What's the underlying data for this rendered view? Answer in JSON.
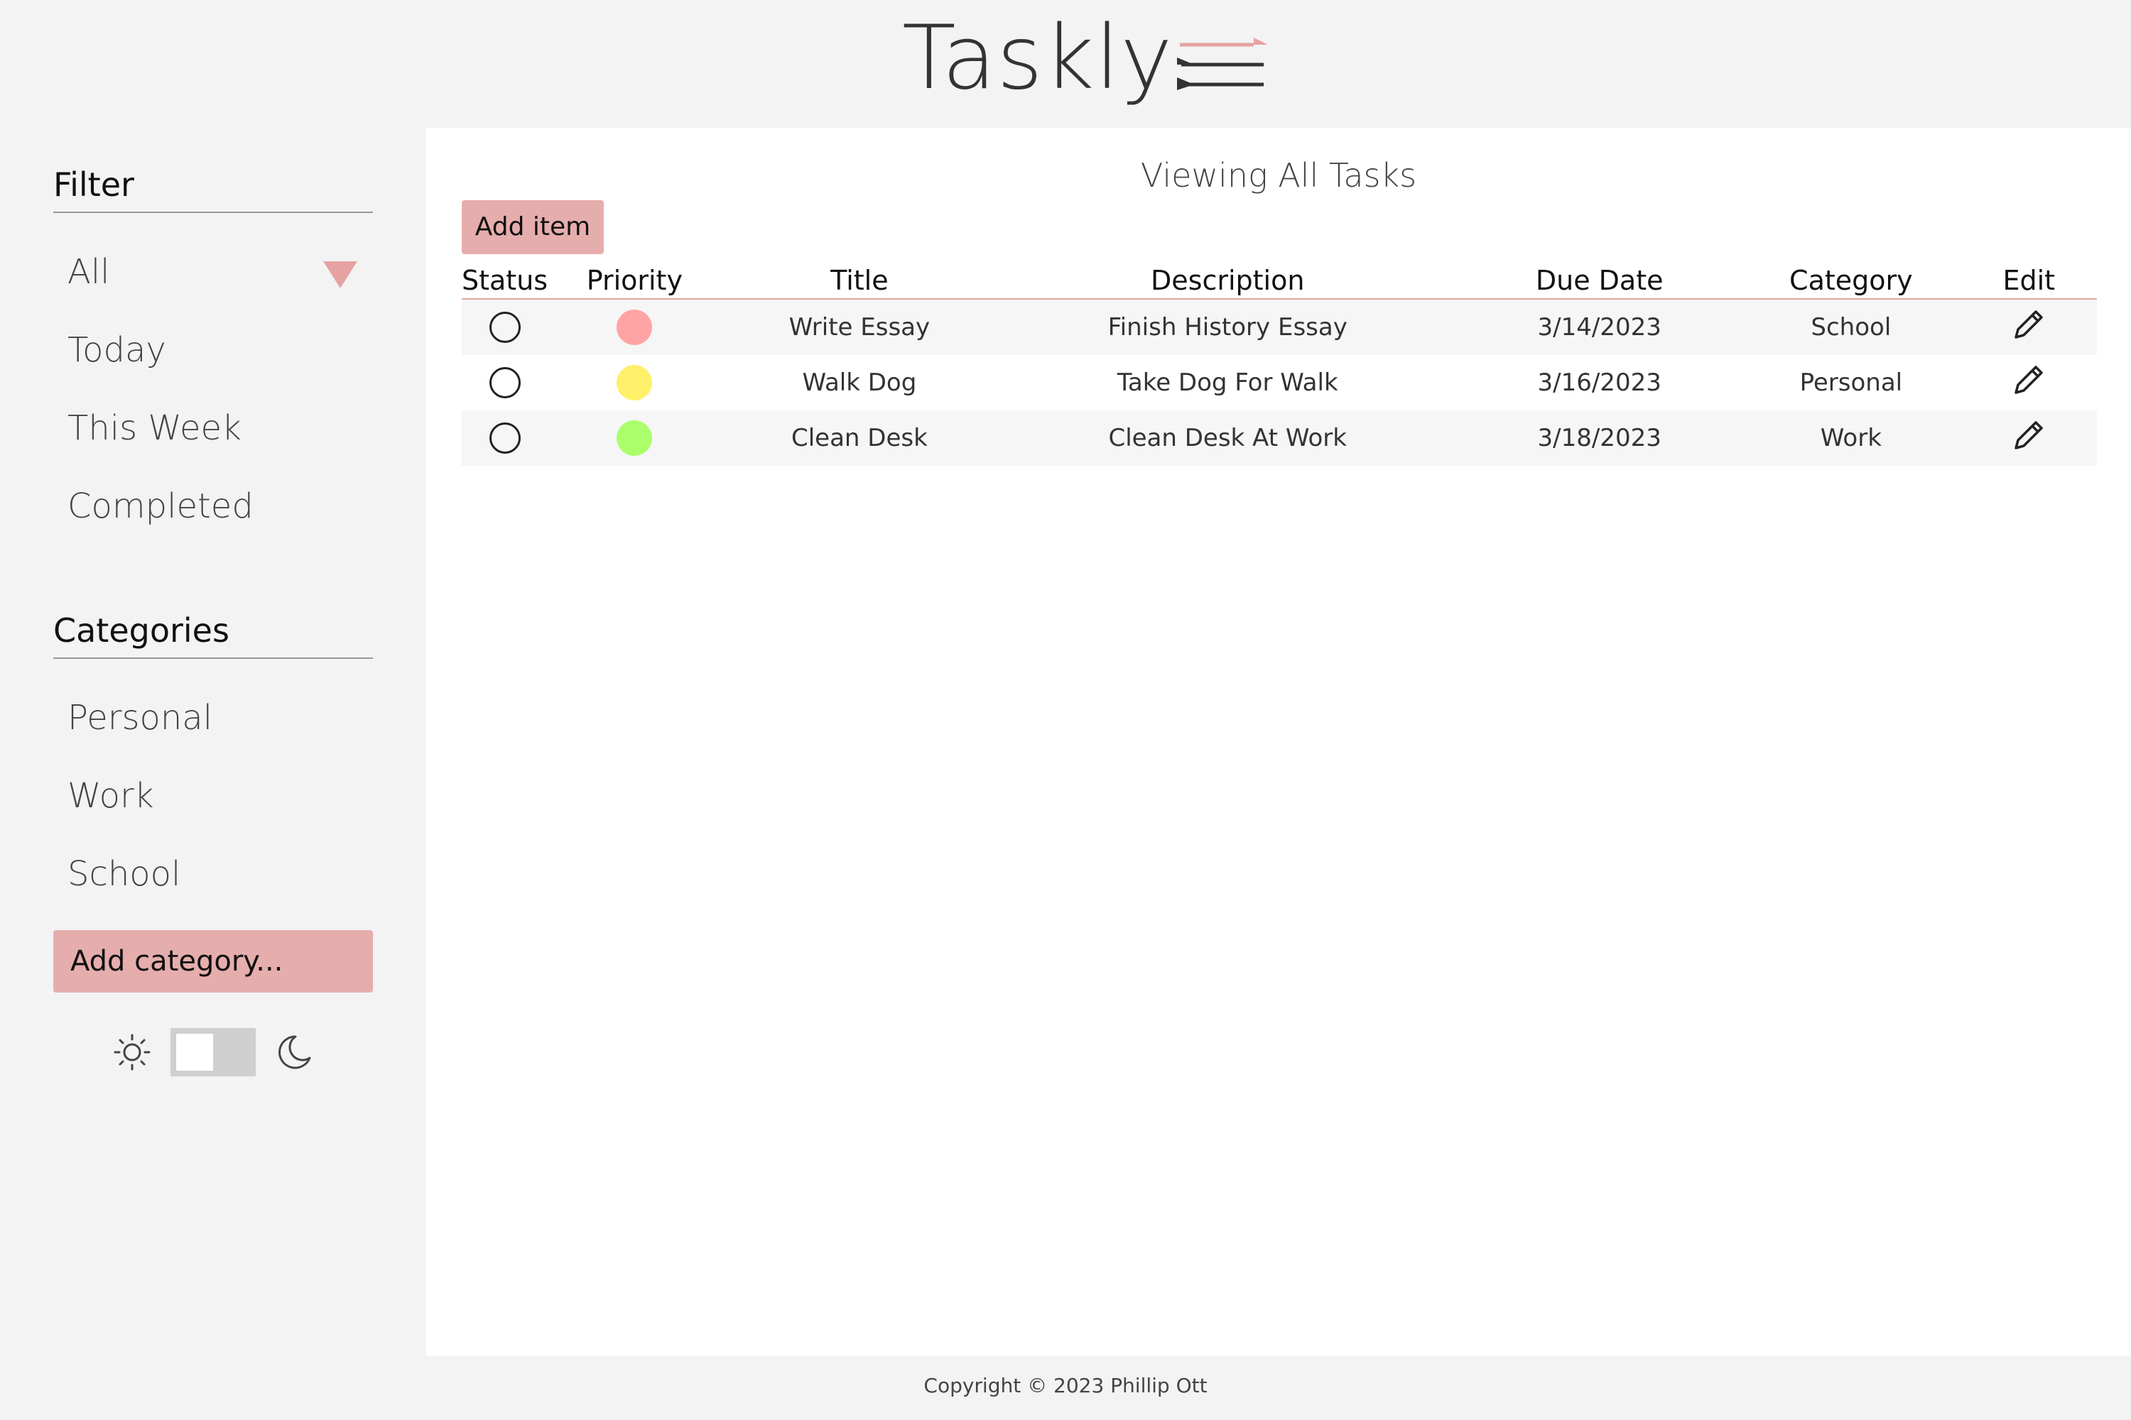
{
  "app": {
    "logo_text": "Taskly",
    "accent_color": "#e6a2a2"
  },
  "sidebar": {
    "filter_title": "Filter",
    "filters": [
      {
        "label": "All"
      },
      {
        "label": "Today"
      },
      {
        "label": "This Week"
      },
      {
        "label": "Completed"
      }
    ],
    "selected_filter_indicator": "dropdown-arrow-icon",
    "categories_title": "Categories",
    "categories": [
      {
        "label": "Personal"
      },
      {
        "label": "Work"
      },
      {
        "label": "School"
      }
    ],
    "add_category_label": "Add category...",
    "theme_toggle": {
      "light_icon": "sun-icon",
      "dark_icon": "moon-icon",
      "state": "light"
    }
  },
  "main": {
    "title": "Viewing All Tasks",
    "add_item_label": "Add item",
    "columns": [
      "Status",
      "Priority",
      "Title",
      "Description",
      "Due Date",
      "Category",
      "Edit"
    ],
    "tasks": [
      {
        "status": "incomplete",
        "priority_color": "#ffa4a4",
        "title": "Write Essay",
        "description": "Finish History Essay",
        "due_date": "3/14/2023",
        "category": "School",
        "edit_icon": "pencil-icon"
      },
      {
        "status": "incomplete",
        "priority_color": "#fff06a",
        "title": "Walk Dog",
        "description": "Take Dog For Walk",
        "due_date": "3/16/2023",
        "category": "Personal",
        "edit_icon": "pencil-icon"
      },
      {
        "status": "incomplete",
        "priority_color": "#aaff6a",
        "title": "Clean Desk",
        "description": "Clean Desk At Work",
        "due_date": "3/18/2023",
        "category": "Work",
        "edit_icon": "pencil-icon"
      }
    ]
  },
  "footer": {
    "copyright": "Copyright © 2023 Phillip Ott"
  }
}
